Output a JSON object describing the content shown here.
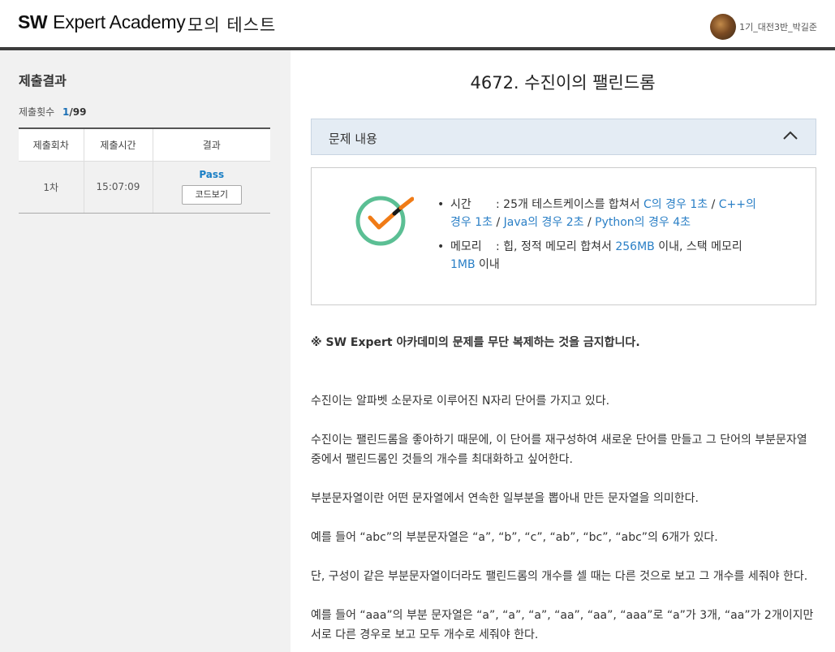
{
  "header": {
    "logo_sw": "SW",
    "logo_rest": "Expert Academy",
    "title": "모의 테스트",
    "username": "1기_대전3반_박길준"
  },
  "sidebar": {
    "title": "제출결과",
    "count_label": "제출횟수",
    "count_current": "1",
    "count_total": "/99",
    "columns": [
      "제출회차",
      "제출시간",
      "결과"
    ],
    "rows": [
      {
        "round": "1차",
        "time": "15:07:09",
        "result": "Pass",
        "button": "코드보기"
      }
    ]
  },
  "main": {
    "problem_title": "4672. 수진이의 팰린드롬",
    "accordion_label": "문제 내용",
    "info": {
      "time_label": "시간",
      "time_prefix": ": 25개 테스트케이스를 합쳐서 ",
      "time_c": "C의 경우 1초",
      "time_cpp": "C++의 경우 1초",
      "time_java": "Java의 경우 2초",
      "time_python": "Python의 경우 4초",
      "sep": " / ",
      "memory_label": "메모리",
      "memory_prefix": ": 힙, 정적 메모리 합쳐서 ",
      "memory_heap": "256MB",
      "memory_mid": " 이내, 스택 메모리 ",
      "memory_stack": "1MB",
      "memory_suffix": " 이내"
    },
    "warning": "※ SW Expert 아카데미의 문제를 무단 복제하는 것을 금지합니다.",
    "paragraphs": [
      "수진이는 알파벳 소문자로 이루어진 N자리 단어를 가지고 있다.",
      "수진이는 팰린드롬을 좋아하기 때문에, 이 단어를 재구성하여 새로운 단어를 만들고 그 단어의 부분문자열 중에서 팰린드롬인 것들의 개수를 최대화하고 싶어한다.",
      "부분문자열이란 어떤 문자열에서 연속한 일부분을 뽑아내 만든 문자열을 의미한다.",
      "예를 들어 “abc”의 부분문자열은 “a”, “b”, “c”, “ab”, “bc”, “abc”의 6개가 있다.",
      "단, 구성이 같은 부분문자열이더라도 팰린드롬의 개수를 셀 때는 다른 것으로 보고 그 개수를 세줘야 한다.",
      "예를 들어 “aaa”의 부분 문자열은 “a”, “a”, “a”, “aa”, “aa”, “aaa”로 “a”가 3개, “aa”가 2개이지만 서로 다른 경우로 보고 모두 개수로 세줘야 한다."
    ]
  },
  "colors": {
    "accent": "#1a7fc5",
    "check_green": "#5bbf94",
    "check_orange": "#f07b16"
  },
  "icons": {
    "accordion": "chevron-up-icon",
    "status": "check-circle-icon"
  }
}
